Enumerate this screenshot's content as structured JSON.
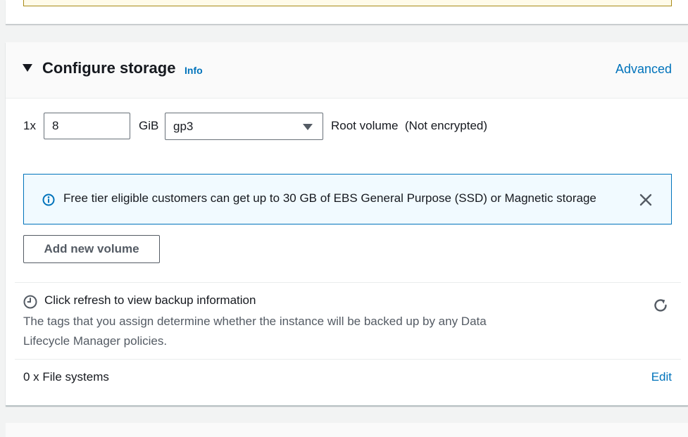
{
  "section": {
    "title": "Configure storage",
    "info_link": "Info",
    "advanced_link": "Advanced"
  },
  "volume": {
    "count_label": "1x",
    "size_value": "8",
    "size_unit": "GiB",
    "type_selected": "gp3",
    "description": "Root volume  (Not encrypted)"
  },
  "alert": {
    "icon": "info-circle-icon",
    "text": "Free tier eligible customers can get up to 30 GB of EBS General Purpose (SSD) or Magnetic storage"
  },
  "add_volume_button": "Add new volume",
  "backup": {
    "title": "Click refresh to view backup information",
    "description": "The tags that you assign determine whether the instance will be backed up by any Data Lifecycle Manager policies."
  },
  "file_systems": {
    "label": "0 x File systems",
    "edit_link": "Edit"
  },
  "colors": {
    "link": "#0073bb",
    "alert_bg": "#f1faff",
    "alert_border": "#0073bb",
    "text": "#16191f",
    "secondary_text": "#545b64"
  }
}
